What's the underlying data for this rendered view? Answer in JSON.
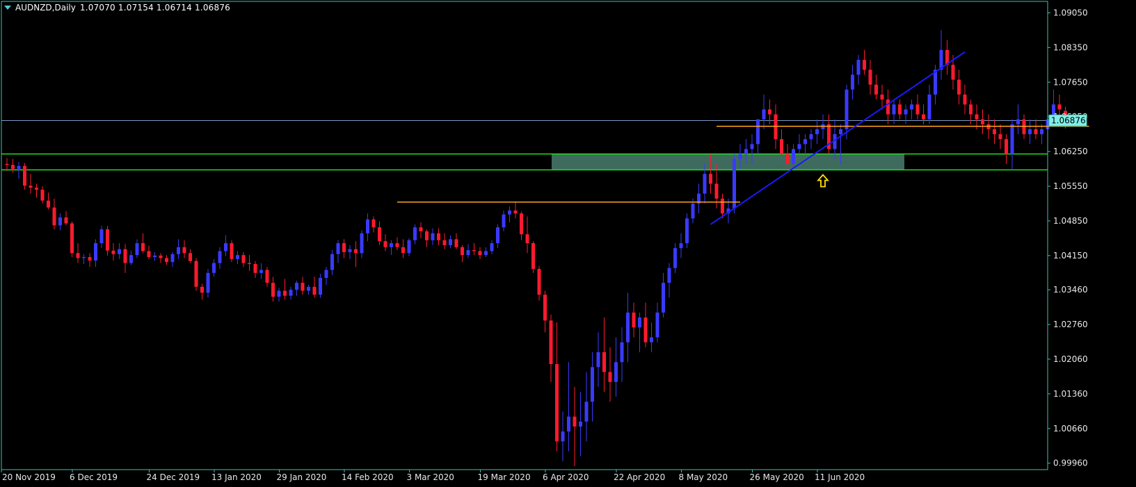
{
  "header": {
    "symbol": "AUDNZD,Daily",
    "ohlc": "1.07070 1.07154 1.06714 1.06876"
  },
  "colors": {
    "background": "#000000",
    "frame": "#3fc2b0",
    "bull": "#3a3aff",
    "bear": "#ff1a2e",
    "wick": "#b02a40",
    "support_zone_fill": "#3e6b5e",
    "support_zone_lines": "#22e01a",
    "level_lines": "#ffa31a",
    "trendline": "#1a1aff",
    "price_line": "#7a9ac8",
    "arrow": "#ffe000",
    "axis_text": "#e8e8e8"
  },
  "chart_data": {
    "type": "candlestick",
    "x_labels": [
      "20 Nov 2019",
      "6 Dec 2019",
      "24 Dec 2019",
      "13 Jan 2020",
      "29 Jan 2020",
      "14 Feb 2020",
      "3 Mar 2020",
      "19 Mar 2020",
      "6 Apr 2020",
      "22 Apr 2020",
      "8 May 2020",
      "26 May 2020",
      "11 Jun 2020"
    ],
    "x_label_bar_index": [
      0,
      12,
      25,
      36,
      47,
      58,
      69,
      81,
      92,
      104,
      115,
      127,
      138
    ],
    "y_ticks": [
      "1.09050",
      "1.08350",
      "1.07650",
      "1.06950",
      "1.06250",
      "1.05550",
      "1.04850",
      "1.04150",
      "1.03460",
      "1.02760",
      "1.02060",
      "1.01360",
      "1.00660",
      "0.99960"
    ],
    "ylim": [
      0.9983,
      1.0928
    ],
    "current_price": "1.06876",
    "candles": [
      [
        1.06,
        1.0612,
        1.0585,
        1.0598
      ],
      [
        1.0598,
        1.061,
        1.0582,
        1.059
      ],
      [
        1.059,
        1.0604,
        1.057,
        1.0596
      ],
      [
        1.0596,
        1.0602,
        1.0548,
        1.0556
      ],
      [
        1.0556,
        1.058,
        1.054,
        1.0552
      ],
      [
        1.0552,
        1.056,
        1.0532,
        1.0548
      ],
      [
        1.0548,
        1.0555,
        1.052,
        1.0526
      ],
      [
        1.0526,
        1.0542,
        1.0508,
        1.0512
      ],
      [
        1.0512,
        1.053,
        1.0468,
        1.0476
      ],
      [
        1.0476,
        1.05,
        1.0466,
        1.0492
      ],
      [
        1.0492,
        1.0505,
        1.0476,
        1.048
      ],
      [
        1.048,
        1.0484,
        1.0412,
        1.042
      ],
      [
        1.042,
        1.044,
        1.04,
        1.041
      ],
      [
        1.041,
        1.0418,
        1.0398,
        1.0412
      ],
      [
        1.0412,
        1.042,
        1.0392,
        1.0405
      ],
      [
        1.0405,
        1.0448,
        1.0392,
        1.044
      ],
      [
        1.044,
        1.0475,
        1.043,
        1.0468
      ],
      [
        1.0468,
        1.0475,
        1.0415,
        1.0425
      ],
      [
        1.0425,
        1.044,
        1.0405,
        1.0418
      ],
      [
        1.0418,
        1.044,
        1.0408,
        1.0428
      ],
      [
        1.0428,
        1.0438,
        1.038,
        1.04
      ],
      [
        1.04,
        1.0425,
        1.0396,
        1.0416
      ],
      [
        1.0416,
        1.0448,
        1.041,
        1.044
      ],
      [
        1.044,
        1.046,
        1.042,
        1.0424
      ],
      [
        1.0424,
        1.0435,
        1.0408,
        1.0412
      ],
      [
        1.0412,
        1.0422,
        1.0404,
        1.0415
      ],
      [
        1.0415,
        1.042,
        1.04,
        1.041
      ],
      [
        1.041,
        1.0416,
        1.0396,
        1.0402
      ],
      [
        1.0402,
        1.0422,
        1.0392,
        1.0418
      ],
      [
        1.0418,
        1.0448,
        1.0408,
        1.0432
      ],
      [
        1.0432,
        1.0446,
        1.041,
        1.042
      ],
      [
        1.042,
        1.0428,
        1.04,
        1.0404
      ],
      [
        1.0404,
        1.041,
        1.0344,
        1.0352
      ],
      [
        1.0352,
        1.0358,
        1.0326,
        1.034
      ],
      [
        1.034,
        1.0388,
        1.033,
        1.038
      ],
      [
        1.038,
        1.0408,
        1.0372,
        1.04
      ],
      [
        1.04,
        1.0432,
        1.0388,
        1.0424
      ],
      [
        1.0424,
        1.0456,
        1.0414,
        1.044
      ],
      [
        1.044,
        1.0446,
        1.0402,
        1.0408
      ],
      [
        1.0408,
        1.0424,
        1.0398,
        1.0416
      ],
      [
        1.0416,
        1.0422,
        1.0392,
        1.04
      ],
      [
        1.04,
        1.0416,
        1.0384,
        1.0398
      ],
      [
        1.0398,
        1.0404,
        1.037,
        1.038
      ],
      [
        1.038,
        1.04,
        1.0368,
        1.0386
      ],
      [
        1.0386,
        1.0392,
        1.0352,
        1.036
      ],
      [
        1.036,
        1.0372,
        1.0322,
        1.0332
      ],
      [
        1.0332,
        1.035,
        1.0322,
        1.0344
      ],
      [
        1.0344,
        1.0368,
        1.0326,
        1.0334
      ],
      [
        1.0334,
        1.0352,
        1.0326,
        1.0346
      ],
      [
        1.0346,
        1.0364,
        1.0334,
        1.036
      ],
      [
        1.036,
        1.0372,
        1.0336,
        1.0344
      ],
      [
        1.0344,
        1.0356,
        1.0336,
        1.0352
      ],
      [
        1.0352,
        1.0372,
        1.033,
        1.0336
      ],
      [
        1.0336,
        1.0378,
        1.033,
        1.037
      ],
      [
        1.037,
        1.0392,
        1.0356,
        1.0386
      ],
      [
        1.0386,
        1.0426,
        1.0376,
        1.0418
      ],
      [
        1.0418,
        1.0446,
        1.04,
        1.044
      ],
      [
        1.044,
        1.0448,
        1.041,
        1.0422
      ],
      [
        1.0422,
        1.0436,
        1.0408,
        1.0428
      ],
      [
        1.0428,
        1.0444,
        1.0392,
        1.042
      ],
      [
        1.042,
        1.0466,
        1.041,
        1.046
      ],
      [
        1.046,
        1.05,
        1.0444,
        1.0488
      ],
      [
        1.0488,
        1.0494,
        1.0462,
        1.0472
      ],
      [
        1.0472,
        1.0484,
        1.0436,
        1.0444
      ],
      [
        1.0444,
        1.0458,
        1.0424,
        1.0432
      ],
      [
        1.0432,
        1.0446,
        1.0416,
        1.044
      ],
      [
        1.044,
        1.0452,
        1.0426,
        1.0432
      ],
      [
        1.0432,
        1.0448,
        1.041,
        1.042
      ],
      [
        1.042,
        1.045,
        1.0414,
        1.0446
      ],
      [
        1.0446,
        1.0478,
        1.0438,
        1.0472
      ],
      [
        1.0472,
        1.0482,
        1.045,
        1.0464
      ],
      [
        1.0464,
        1.0468,
        1.0432,
        1.0446
      ],
      [
        1.0446,
        1.047,
        1.0436,
        1.046
      ],
      [
        1.046,
        1.047,
        1.0436,
        1.0446
      ],
      [
        1.0446,
        1.046,
        1.0428,
        1.0436
      ],
      [
        1.0436,
        1.0456,
        1.043,
        1.0448
      ],
      [
        1.0448,
        1.046,
        1.0428,
        1.0432
      ],
      [
        1.0432,
        1.0436,
        1.0402,
        1.0416
      ],
      [
        1.0416,
        1.0438,
        1.041,
        1.0426
      ],
      [
        1.0426,
        1.044,
        1.0416,
        1.0424
      ],
      [
        1.0424,
        1.0432,
        1.0408,
        1.0416
      ],
      [
        1.0416,
        1.0432,
        1.0412,
        1.0424
      ],
      [
        1.0424,
        1.0446,
        1.0418,
        1.044
      ],
      [
        1.044,
        1.0478,
        1.043,
        1.0472
      ],
      [
        1.0472,
        1.0506,
        1.0464,
        1.0498
      ],
      [
        1.0498,
        1.0514,
        1.0482,
        1.0506
      ],
      [
        1.0506,
        1.0524,
        1.049,
        1.05
      ],
      [
        1.05,
        1.0504,
        1.0446,
        1.0458
      ],
      [
        1.0458,
        1.0494,
        1.042,
        1.044
      ],
      [
        1.044,
        1.0444,
        1.038,
        1.0388
      ],
      [
        1.0388,
        1.0394,
        1.0324,
        1.0336
      ],
      [
        1.0336,
        1.0344,
        1.026,
        1.0284
      ],
      [
        1.0284,
        1.0296,
        1.016,
        1.0196
      ],
      [
        1.0196,
        1.028,
        1.002,
        1.004
      ],
      [
        1.004,
        1.01,
        1.0,
        1.006
      ],
      [
        1.006,
        1.02,
        1.002,
        1.009
      ],
      [
        1.009,
        1.015,
        0.999,
        1.007
      ],
      [
        1.007,
        1.014,
        1.001,
        1.008
      ],
      [
        1.008,
        1.018,
        1.004,
        1.012
      ],
      [
        1.012,
        1.022,
        1.008,
        1.019
      ],
      [
        1.019,
        1.026,
        1.015,
        1.022
      ],
      [
        1.022,
        1.029,
        1.014,
        1.018
      ],
      [
        1.018,
        1.023,
        1.012,
        1.016
      ],
      [
        1.016,
        1.025,
        1.013,
        1.02
      ],
      [
        1.02,
        1.027,
        1.016,
        1.024
      ],
      [
        1.024,
        1.034,
        1.02,
        1.03
      ],
      [
        1.03,
        1.032,
        1.025,
        1.027
      ],
      [
        1.027,
        1.03,
        1.022,
        1.029
      ],
      [
        1.029,
        1.032,
        1.023,
        1.024
      ],
      [
        1.024,
        1.028,
        1.022,
        1.025
      ],
      [
        1.025,
        1.032,
        1.024,
        1.03
      ],
      [
        1.03,
        1.038,
        1.029,
        1.036
      ],
      [
        1.036,
        1.04,
        1.033,
        1.039
      ],
      [
        1.039,
        1.044,
        1.038,
        1.043
      ],
      [
        1.043,
        1.046,
        1.041,
        1.044
      ],
      [
        1.044,
        1.05,
        1.043,
        1.049
      ],
      [
        1.049,
        1.053,
        1.048,
        1.052
      ],
      [
        1.052,
        1.056,
        1.05,
        1.054
      ],
      [
        1.054,
        1.06,
        1.052,
        1.058
      ],
      [
        1.058,
        1.062,
        1.054,
        1.056
      ],
      [
        1.056,
        1.06,
        1.051,
        1.053
      ],
      [
        1.053,
        1.054,
        1.049,
        1.05
      ],
      [
        1.05,
        1.053,
        1.048,
        1.051
      ],
      [
        1.051,
        1.062,
        1.05,
        1.061
      ],
      [
        1.061,
        1.064,
        1.059,
        1.062
      ],
      [
        1.062,
        1.065,
        1.06,
        1.063
      ],
      [
        1.063,
        1.066,
        1.06,
        1.064
      ],
      [
        1.064,
        1.069,
        1.062,
        1.069
      ],
      [
        1.069,
        1.074,
        1.067,
        1.071
      ],
      [
        1.071,
        1.073,
        1.068,
        1.07
      ],
      [
        1.07,
        1.072,
        1.063,
        1.065
      ],
      [
        1.065,
        1.067,
        1.06,
        1.062
      ],
      [
        1.062,
        1.064,
        1.059,
        1.06
      ],
      [
        1.06,
        1.064,
        1.059,
        1.063
      ],
      [
        1.063,
        1.066,
        1.062,
        1.064
      ],
      [
        1.064,
        1.066,
        1.062,
        1.065
      ],
      [
        1.065,
        1.067,
        1.063,
        1.066
      ],
      [
        1.066,
        1.069,
        1.064,
        1.067
      ],
      [
        1.067,
        1.07,
        1.065,
        1.068
      ],
      [
        1.068,
        1.07,
        1.062,
        1.063
      ],
      [
        1.063,
        1.069,
        1.061,
        1.066
      ],
      [
        1.066,
        1.068,
        1.06,
        1.067
      ],
      [
        1.067,
        1.076,
        1.065,
        1.075
      ],
      [
        1.075,
        1.08,
        1.073,
        1.078
      ],
      [
        1.078,
        1.082,
        1.076,
        1.081
      ],
      [
        1.081,
        1.083,
        1.078,
        1.079
      ],
      [
        1.079,
        1.081,
        1.074,
        1.076
      ],
      [
        1.076,
        1.078,
        1.073,
        1.074
      ],
      [
        1.074,
        1.076,
        1.071,
        1.073
      ],
      [
        1.073,
        1.075,
        1.068,
        1.07
      ],
      [
        1.07,
        1.073,
        1.068,
        1.072
      ],
      [
        1.072,
        1.073,
        1.069,
        1.07
      ],
      [
        1.07,
        1.072,
        1.068,
        1.071
      ],
      [
        1.071,
        1.073,
        1.069,
        1.072
      ],
      [
        1.072,
        1.074,
        1.069,
        1.07
      ],
      [
        1.07,
        1.072,
        1.068,
        1.069
      ],
      [
        1.069,
        1.076,
        1.068,
        1.074
      ],
      [
        1.074,
        1.08,
        1.072,
        1.079
      ],
      [
        1.079,
        1.087,
        1.077,
        1.083
      ],
      [
        1.083,
        1.085,
        1.078,
        1.08
      ],
      [
        1.08,
        1.082,
        1.075,
        1.077
      ],
      [
        1.077,
        1.079,
        1.072,
        1.074
      ],
      [
        1.074,
        1.076,
        1.07,
        1.072
      ],
      [
        1.072,
        1.073,
        1.068,
        1.07
      ],
      [
        1.07,
        1.072,
        1.067,
        1.069
      ],
      [
        1.069,
        1.071,
        1.066,
        1.068
      ],
      [
        1.068,
        1.07,
        1.065,
        1.067
      ],
      [
        1.067,
        1.069,
        1.064,
        1.066
      ],
      [
        1.066,
        1.068,
        1.063,
        1.065
      ],
      [
        1.065,
        1.066,
        1.06,
        1.062
      ],
      [
        1.062,
        1.069,
        1.059,
        1.068
      ],
      [
        1.068,
        1.072,
        1.066,
        1.069
      ],
      [
        1.069,
        1.07,
        1.065,
        1.066
      ],
      [
        1.066,
        1.069,
        1.064,
        1.067
      ],
      [
        1.067,
        1.069,
        1.065,
        1.066
      ],
      [
        1.066,
        1.068,
        1.064,
        1.067
      ],
      [
        1.067,
        1.07,
        1.065,
        1.069
      ],
      [
        1.069,
        1.075,
        1.068,
        1.072
      ],
      [
        1.072,
        1.074,
        1.069,
        1.071
      ],
      [
        1.0707,
        1.07154,
        1.06714,
        1.06876
      ]
    ],
    "support_zone": {
      "low": 1.0588,
      "high": 1.062
    },
    "levels": [
      {
        "price": 1.0523,
        "from_bar": 66,
        "to_bar": 124
      },
      {
        "price": 1.0676,
        "from_bar": 120,
        "to_bar": 183
      }
    ],
    "trendline": {
      "from_bar": 119,
      "from_price": 1.0478,
      "to_bar": 162,
      "to_price": 1.0826
    },
    "annotations": [
      {
        "type": "arrow-up",
        "bar": 138,
        "price": 1.0578
      }
    ]
  }
}
